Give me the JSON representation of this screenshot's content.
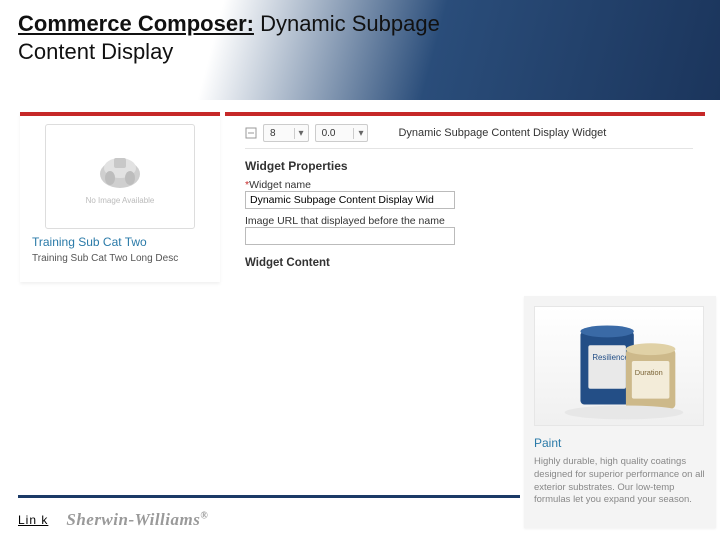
{
  "title": {
    "strong": "Commerce Composer:",
    "rest": " Dynamic Subpage Content Display"
  },
  "left_card": {
    "no_image_label": "No Image Available",
    "link_text": "Training Sub Cat Two",
    "desc_text": "Training Sub Cat Two Long Desc"
  },
  "props": {
    "select_a": "8",
    "select_b": "0.0",
    "header_text": "Dynamic Subpage Content Display Widget",
    "section_title": "Widget Properties",
    "name_label": "Widget name",
    "name_value": "Dynamic Subpage Content Display Wid",
    "image_url_label": "Image URL that displayed before the name",
    "image_url_value": "",
    "content_title": "Widget Content"
  },
  "product": {
    "title": "Paint",
    "desc": "Highly durable, high quality coatings designed for superior performance on all exterior substrates. Our low-temp formulas let you expand your season."
  },
  "footer": {
    "link": "Lin k",
    "brand": "Sherwin-Williams"
  }
}
